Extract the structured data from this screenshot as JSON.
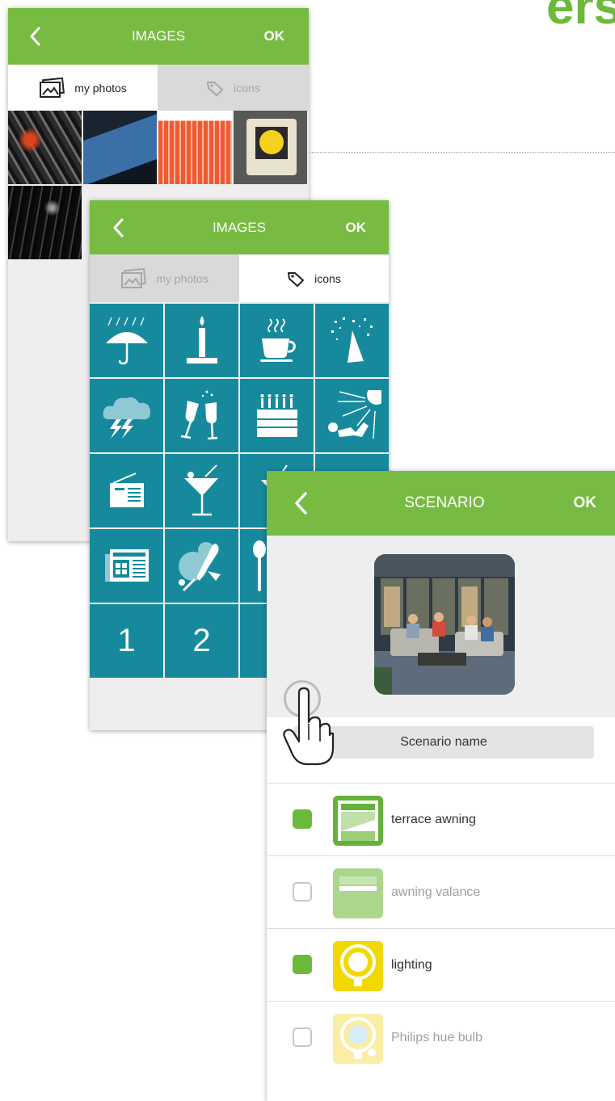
{
  "brand_fragment": "ers",
  "images_screen_photos": {
    "title": "IMAGES",
    "ok_label": "OK",
    "tabs": [
      {
        "label": "my photos",
        "icon": "photo-icon",
        "active": true
      },
      {
        "label": "icons",
        "icon": "tag-icon",
        "active": false
      }
    ]
  },
  "images_screen_icons": {
    "title": "IMAGES",
    "ok_label": "OK",
    "tabs": [
      {
        "label": "my photos",
        "icon": "photo-icon",
        "active": false
      },
      {
        "label": "icons",
        "icon": "tag-icon",
        "active": true
      }
    ],
    "icons": [
      "umbrella-rain-icon",
      "candle-icon",
      "coffee-cup-icon",
      "party-hat-confetti-icon",
      "storm-cloud-icon",
      "champagne-glasses-icon",
      "birthday-cake-icon",
      "sunbathing-icon",
      "radio-icon",
      "cocktail-glass-icon",
      "cocktail-icon",
      "",
      "newspaper-icon",
      "badminton-icon",
      "spoon-icon",
      "",
      "1",
      "2",
      "",
      ""
    ]
  },
  "scenario_screen": {
    "title": "SCENARIO",
    "ok_label": "OK",
    "name_field": "Scenario name",
    "items": [
      {
        "label": "terrace awning",
        "checked": true,
        "icon": "awning-icon",
        "enabled": true
      },
      {
        "label": "awning valance",
        "checked": false,
        "icon": "awning-valance-icon",
        "enabled": false
      },
      {
        "label": "lighting",
        "checked": true,
        "icon": "light-bulb-icon",
        "enabled": true
      },
      {
        "label": "Philips hue bulb",
        "checked": false,
        "icon": "hue-bulb-icon",
        "enabled": false
      }
    ]
  },
  "colors": {
    "accent_green": "#77bb43",
    "check_green": "#6cba3b",
    "tile_teal": "#168a9c",
    "bulb_yellow": "#f2d800"
  }
}
